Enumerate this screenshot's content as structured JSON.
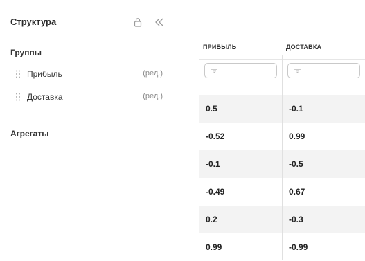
{
  "sidebar": {
    "title": "Структура",
    "groups_title": "Группы",
    "groups": [
      {
        "label": "Прибыль",
        "edit": "(ред.)"
      },
      {
        "label": "Доставка",
        "edit": "(ред.)"
      }
    ],
    "aggregates_title": "Агрегаты"
  },
  "grid": {
    "columns": [
      {
        "header": "ПРИБЫЛЬ",
        "filter_icon": "filter-icon"
      },
      {
        "header": "ДОСТАВКА",
        "filter_icon": "filter-icon"
      }
    ],
    "rows": [
      {
        "profit": "0.5",
        "delivery": "-0.1"
      },
      {
        "profit": "-0.52",
        "delivery": "0.99"
      },
      {
        "profit": "-0.1",
        "delivery": "-0.5"
      },
      {
        "profit": "-0.49",
        "delivery": "0.67"
      },
      {
        "profit": "0.2",
        "delivery": "-0.3"
      },
      {
        "profit": "0.99",
        "delivery": "-0.99"
      }
    ]
  },
  "colors": {
    "alt_row": "#f3f3f3",
    "divider": "#e1e1e1",
    "muted_text": "#8a8a8a"
  }
}
